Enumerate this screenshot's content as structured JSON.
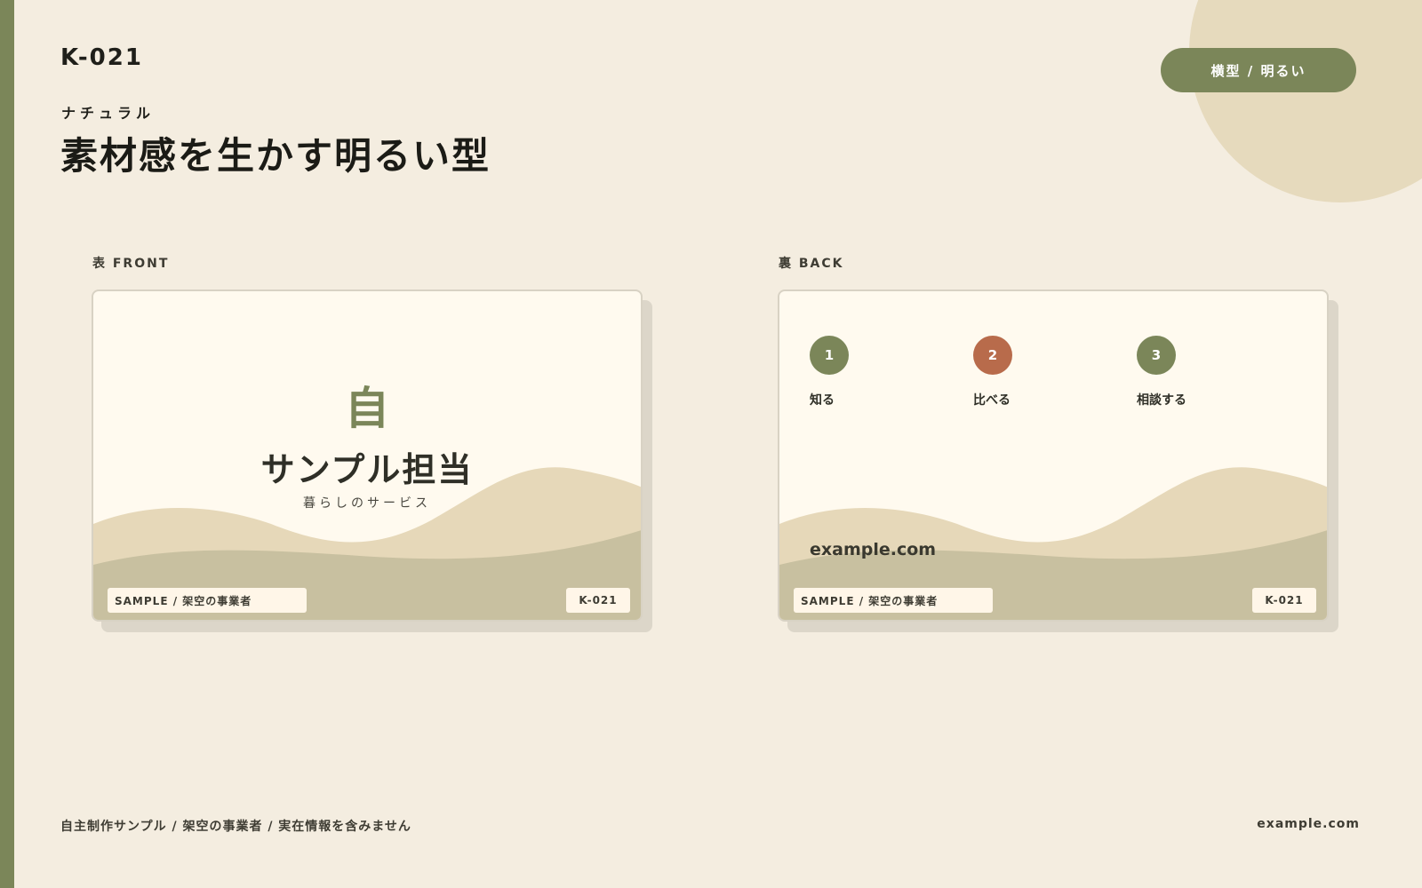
{
  "header": {
    "code": "K-021",
    "subtitle": "ナチュラル",
    "headline": "素材感を生かす明るい型",
    "badge": "横型 / 明るい"
  },
  "colors": {
    "accent": "#7b8659",
    "accent_alt": "#b86b4b",
    "background": "#f4ede0",
    "card": "#fffaef",
    "wave_light": "#e6d8b9",
    "wave_dark": "#c8c0a0"
  },
  "front": {
    "label": "表 FRONT",
    "kanji": "自",
    "name": "サンプル担当",
    "service": "暮らしのサービス",
    "tag_left": "SAMPLE / 架空の事業者",
    "tag_right": "K-021"
  },
  "back": {
    "label": "裏 BACK",
    "steps": [
      {
        "number": "1",
        "label": "知る"
      },
      {
        "number": "2",
        "label": "比べる"
      },
      {
        "number": "3",
        "label": "相談する"
      }
    ],
    "url": "example.com",
    "tag_left": "SAMPLE / 架空の事業者",
    "tag_right": "K-021"
  },
  "footer": {
    "note": "自主制作サンプル / 架空の事業者 / 実在情報を含みません",
    "url": "example.com"
  }
}
